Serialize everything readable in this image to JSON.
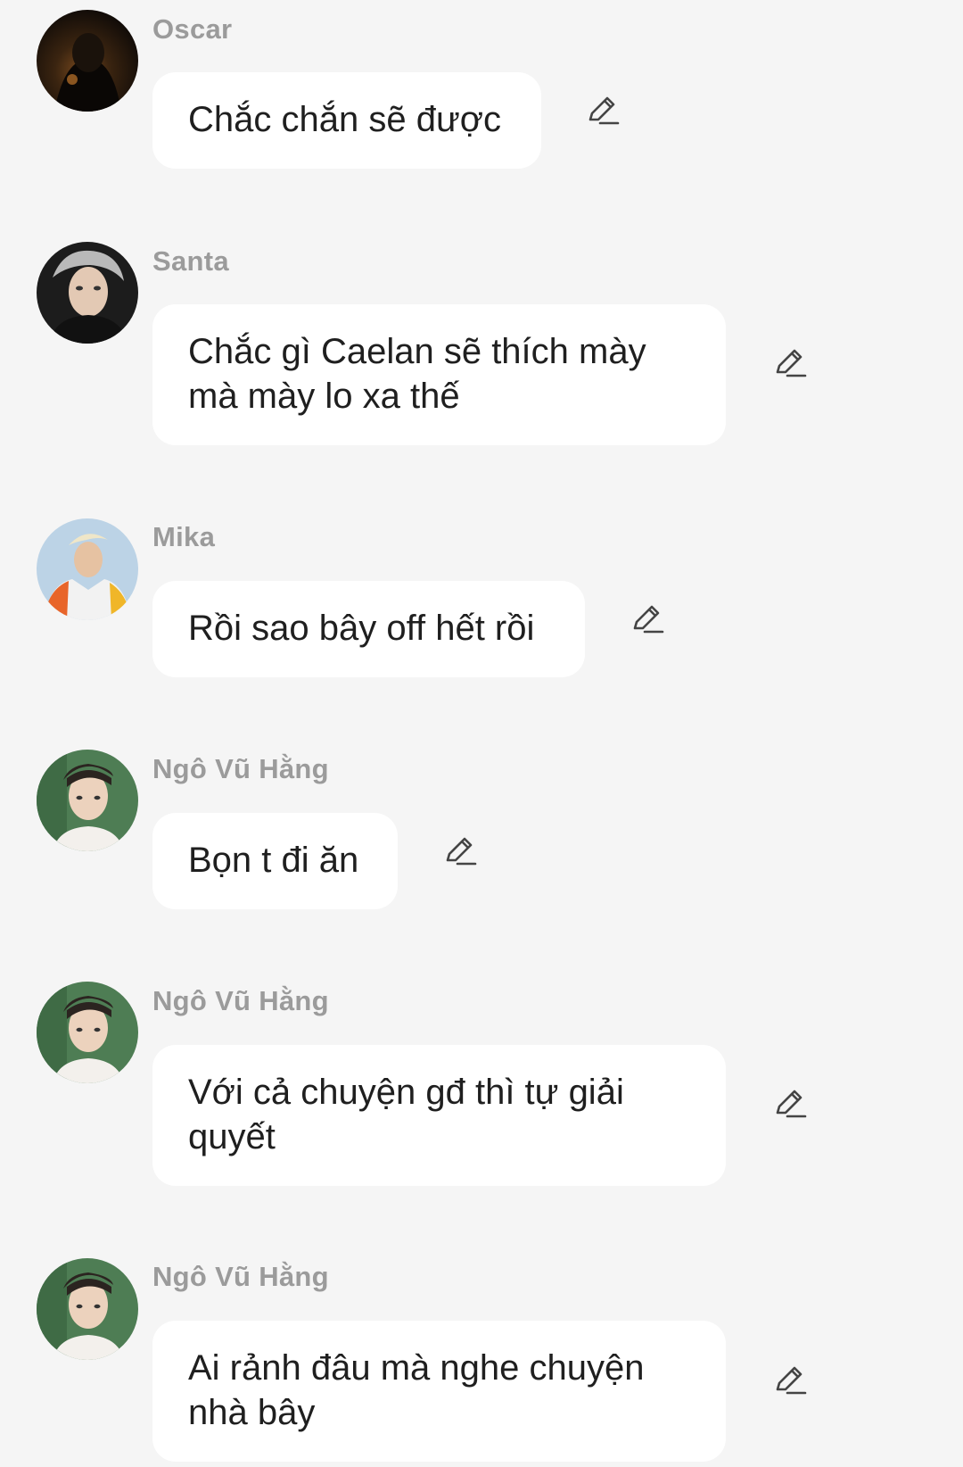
{
  "messages": [
    {
      "sender": "Oscar",
      "text": "Chắc chắn sẽ được",
      "avatar": "dark-silhouette-avatar"
    },
    {
      "sender": "Santa",
      "text": "Chắc gì Caelan sẽ thích mày mà mày lo xa thế",
      "avatar": "grey-hair-portrait-avatar"
    },
    {
      "sender": "Mika",
      "text": "Rồi sao bây off hết rồi",
      "avatar": "blonde-portrait-avatar"
    },
    {
      "sender": "Ngô Vũ Hằng",
      "text": "Bọn t đi ăn",
      "avatar": "green-background-portrait-avatar"
    },
    {
      "sender": "Ngô Vũ Hằng",
      "text": "Với cả chuyện gđ thì tự giải quyết",
      "avatar": "green-background-portrait-avatar"
    },
    {
      "sender": "Ngô Vũ Hằng",
      "text": "Ai rảnh đâu mà nghe chuyện nhà bây",
      "avatar": "green-background-portrait-avatar"
    }
  ],
  "edit_icon": "pencil-edit-icon",
  "colors": {
    "background": "#f5f5f5",
    "bubble": "#ffffff",
    "name": "#9b9b9b",
    "text": "#1f1f1f",
    "icon": "#444444"
  }
}
